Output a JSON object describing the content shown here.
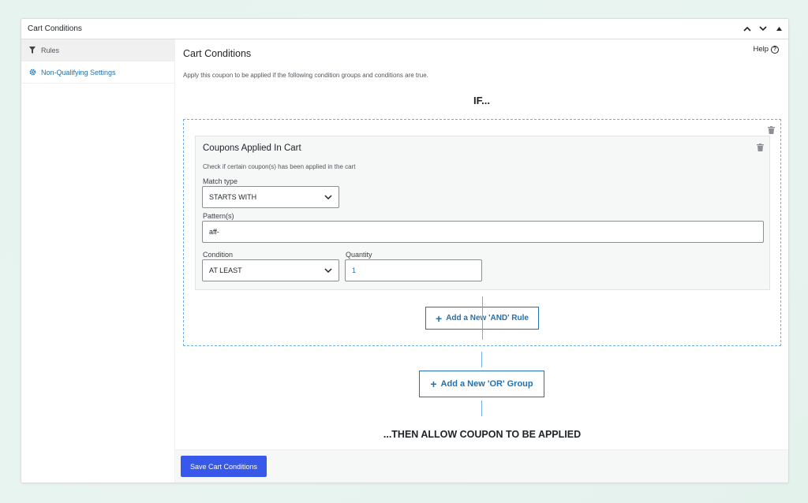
{
  "panel": {
    "title": "Cart Conditions"
  },
  "sidebar": {
    "items": [
      {
        "label": "Rules",
        "icon": "filter-icon"
      },
      {
        "label": "Non-Qualifying Settings",
        "icon": "gear-icon"
      }
    ]
  },
  "main": {
    "title": "Cart Conditions",
    "help_label": "Help",
    "description": "Apply this coupon to be applied if the following condition groups and conditions are true.",
    "if_label": "IF...",
    "then_label": "...THEN ALLOW COUPON TO BE APPLIED"
  },
  "rule": {
    "title": "Coupons Applied In Cart",
    "description": "Check if certain coupon(s) has been applied in the cart",
    "match_type_label": "Match type",
    "match_type_value": "STARTS WITH",
    "patterns_label": "Pattern(s)",
    "patterns_value": "aff-",
    "condition_label": "Condition",
    "condition_value": "AT LEAST",
    "quantity_label": "Quantity",
    "quantity_value": "1"
  },
  "buttons": {
    "add_and": "Add a New 'AND' Rule",
    "add_or": "Add a New 'OR' Group",
    "save": "Save Cart Conditions"
  },
  "colors": {
    "accent": "#2271b1",
    "primary_button": "#3858e9",
    "dashed_border": "#72aee6"
  }
}
